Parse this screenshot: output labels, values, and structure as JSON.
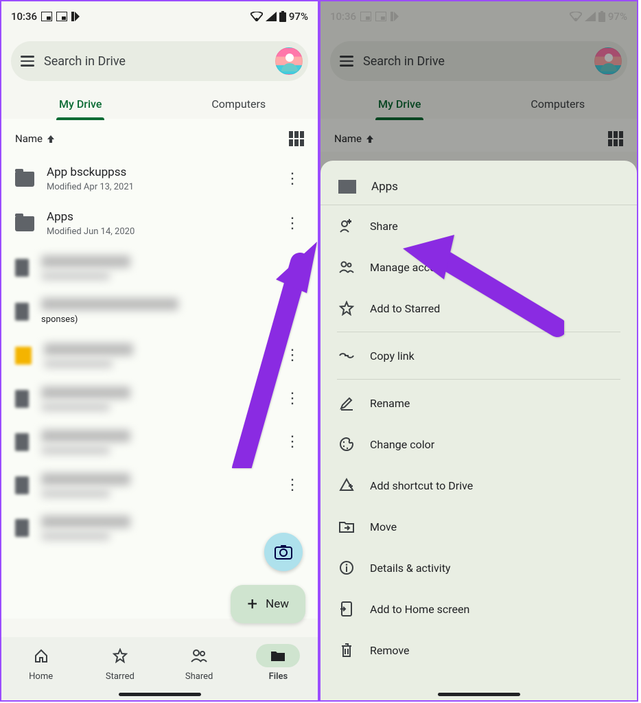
{
  "status": {
    "time": "10:36",
    "battery": "97%"
  },
  "search": {
    "placeholder": "Search in Drive"
  },
  "tabs": {
    "mydrive": "My Drive",
    "computers": "Computers"
  },
  "sort": {
    "label": "Name"
  },
  "files": [
    {
      "title": "App bsckuppss",
      "sub": "Modified Apr 13, 2021"
    },
    {
      "title": "Apps",
      "sub": "Modified Jun 14, 2020"
    },
    {
      "title_fragment": "sponses)"
    }
  ],
  "fab": {
    "new": "New"
  },
  "nav": {
    "home": "Home",
    "starred": "Starred",
    "shared": "Shared",
    "files": "Files"
  },
  "sheet": {
    "title": "Apps",
    "share": "Share",
    "manage": "Manage access",
    "starred": "Add to Starred",
    "copylink": "Copy link",
    "rename": "Rename",
    "color": "Change color",
    "shortcut": "Add shortcut to Drive",
    "move": "Move",
    "details": "Details & activity",
    "homescreen": "Add to Home screen",
    "remove": "Remove"
  }
}
